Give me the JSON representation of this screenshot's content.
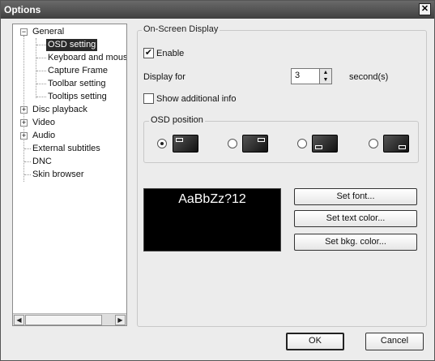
{
  "window": {
    "title": "Options"
  },
  "tree": {
    "items": [
      {
        "label": "General",
        "expander": "−"
      },
      {
        "label": "OSD setting"
      },
      {
        "label": "Keyboard and mouse"
      },
      {
        "label": "Capture Frame"
      },
      {
        "label": "Toolbar setting"
      },
      {
        "label": "Tooltips setting"
      },
      {
        "label": "Disc playback",
        "expander": "+"
      },
      {
        "label": "Video",
        "expander": "+"
      },
      {
        "label": "Audio",
        "expander": "+"
      },
      {
        "label": "External subtitles"
      },
      {
        "label": "DNC"
      },
      {
        "label": "Skin browser"
      }
    ]
  },
  "osd": {
    "section_title": "On-Screen Display",
    "enable_label": "Enable",
    "enable_checked": true,
    "display_for_label": "Display for",
    "display_for_value": "3",
    "unit_label": "second(s)",
    "show_additional_label": "Show additional info",
    "show_additional_checked": false,
    "position_title": "OSD position",
    "preview_text": "AaBbZz?12"
  },
  "buttons": {
    "set_font": "Set font...",
    "set_text_color": "Set text color...",
    "set_bkg_color": "Set bkg. color...",
    "ok": "OK",
    "cancel": "Cancel"
  }
}
